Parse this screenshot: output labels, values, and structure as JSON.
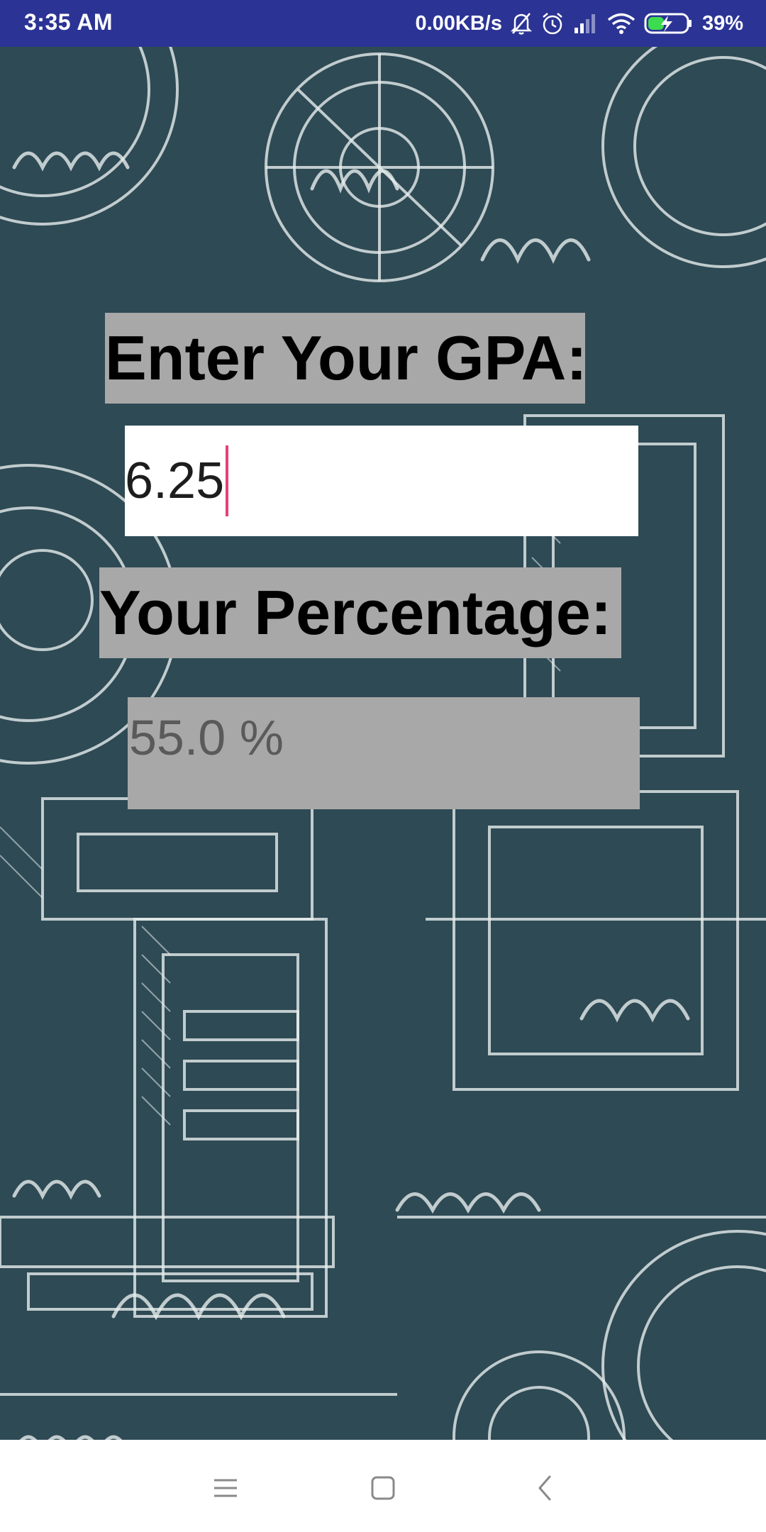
{
  "status_bar": {
    "time": "3:35 AM",
    "network_speed": "0.00KB/s",
    "battery_percent": "39%",
    "icons": [
      "mute-bell-icon",
      "alarm-icon",
      "signal-icon",
      "wifi-icon",
      "battery-charging-icon"
    ]
  },
  "app": {
    "gpa_heading": "Enter Your GPA:",
    "gpa_input_value": "6.25",
    "percentage_heading": "Your Percentage:",
    "percentage_value": "55.0 %"
  },
  "nav_bar": {
    "icons": [
      "menu-icon",
      "home-icon",
      "back-icon"
    ]
  },
  "colors": {
    "status_bar_bg": "#2b3494",
    "app_bg": "#2e4a54",
    "label_bg": "#a8a8a8",
    "cursor": "#e6407a"
  }
}
